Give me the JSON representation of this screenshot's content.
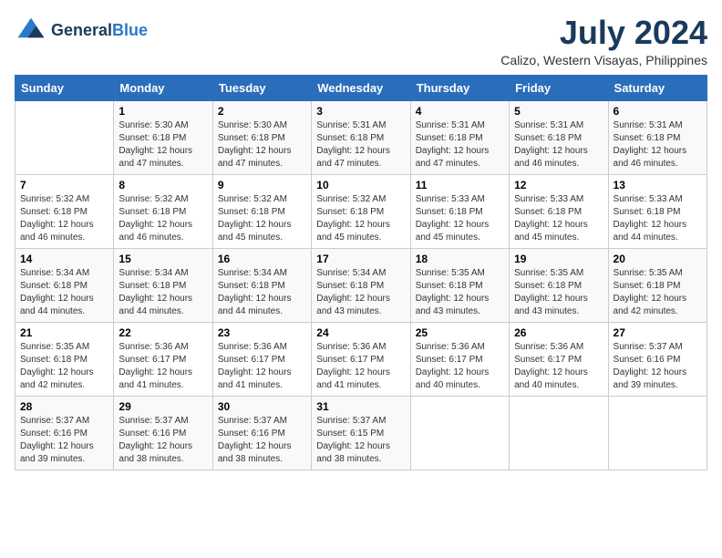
{
  "header": {
    "logo_line1": "General",
    "logo_line2": "Blue",
    "month": "July 2024",
    "location": "Calizo, Western Visayas, Philippines"
  },
  "weekdays": [
    "Sunday",
    "Monday",
    "Tuesday",
    "Wednesday",
    "Thursday",
    "Friday",
    "Saturday"
  ],
  "weeks": [
    [
      {
        "day": "",
        "info": ""
      },
      {
        "day": "1",
        "info": "Sunrise: 5:30 AM\nSunset: 6:18 PM\nDaylight: 12 hours\nand 47 minutes."
      },
      {
        "day": "2",
        "info": "Sunrise: 5:30 AM\nSunset: 6:18 PM\nDaylight: 12 hours\nand 47 minutes."
      },
      {
        "day": "3",
        "info": "Sunrise: 5:31 AM\nSunset: 6:18 PM\nDaylight: 12 hours\nand 47 minutes."
      },
      {
        "day": "4",
        "info": "Sunrise: 5:31 AM\nSunset: 6:18 PM\nDaylight: 12 hours\nand 47 minutes."
      },
      {
        "day": "5",
        "info": "Sunrise: 5:31 AM\nSunset: 6:18 PM\nDaylight: 12 hours\nand 46 minutes."
      },
      {
        "day": "6",
        "info": "Sunrise: 5:31 AM\nSunset: 6:18 PM\nDaylight: 12 hours\nand 46 minutes."
      }
    ],
    [
      {
        "day": "7",
        "info": "Sunrise: 5:32 AM\nSunset: 6:18 PM\nDaylight: 12 hours\nand 46 minutes."
      },
      {
        "day": "8",
        "info": "Sunrise: 5:32 AM\nSunset: 6:18 PM\nDaylight: 12 hours\nand 46 minutes."
      },
      {
        "day": "9",
        "info": "Sunrise: 5:32 AM\nSunset: 6:18 PM\nDaylight: 12 hours\nand 45 minutes."
      },
      {
        "day": "10",
        "info": "Sunrise: 5:32 AM\nSunset: 6:18 PM\nDaylight: 12 hours\nand 45 minutes."
      },
      {
        "day": "11",
        "info": "Sunrise: 5:33 AM\nSunset: 6:18 PM\nDaylight: 12 hours\nand 45 minutes."
      },
      {
        "day": "12",
        "info": "Sunrise: 5:33 AM\nSunset: 6:18 PM\nDaylight: 12 hours\nand 45 minutes."
      },
      {
        "day": "13",
        "info": "Sunrise: 5:33 AM\nSunset: 6:18 PM\nDaylight: 12 hours\nand 44 minutes."
      }
    ],
    [
      {
        "day": "14",
        "info": "Sunrise: 5:34 AM\nSunset: 6:18 PM\nDaylight: 12 hours\nand 44 minutes."
      },
      {
        "day": "15",
        "info": "Sunrise: 5:34 AM\nSunset: 6:18 PM\nDaylight: 12 hours\nand 44 minutes."
      },
      {
        "day": "16",
        "info": "Sunrise: 5:34 AM\nSunset: 6:18 PM\nDaylight: 12 hours\nand 44 minutes."
      },
      {
        "day": "17",
        "info": "Sunrise: 5:34 AM\nSunset: 6:18 PM\nDaylight: 12 hours\nand 43 minutes."
      },
      {
        "day": "18",
        "info": "Sunrise: 5:35 AM\nSunset: 6:18 PM\nDaylight: 12 hours\nand 43 minutes."
      },
      {
        "day": "19",
        "info": "Sunrise: 5:35 AM\nSunset: 6:18 PM\nDaylight: 12 hours\nand 43 minutes."
      },
      {
        "day": "20",
        "info": "Sunrise: 5:35 AM\nSunset: 6:18 PM\nDaylight: 12 hours\nand 42 minutes."
      }
    ],
    [
      {
        "day": "21",
        "info": "Sunrise: 5:35 AM\nSunset: 6:18 PM\nDaylight: 12 hours\nand 42 minutes."
      },
      {
        "day": "22",
        "info": "Sunrise: 5:36 AM\nSunset: 6:17 PM\nDaylight: 12 hours\nand 41 minutes."
      },
      {
        "day": "23",
        "info": "Sunrise: 5:36 AM\nSunset: 6:17 PM\nDaylight: 12 hours\nand 41 minutes."
      },
      {
        "day": "24",
        "info": "Sunrise: 5:36 AM\nSunset: 6:17 PM\nDaylight: 12 hours\nand 41 minutes."
      },
      {
        "day": "25",
        "info": "Sunrise: 5:36 AM\nSunset: 6:17 PM\nDaylight: 12 hours\nand 40 minutes."
      },
      {
        "day": "26",
        "info": "Sunrise: 5:36 AM\nSunset: 6:17 PM\nDaylight: 12 hours\nand 40 minutes."
      },
      {
        "day": "27",
        "info": "Sunrise: 5:37 AM\nSunset: 6:16 PM\nDaylight: 12 hours\nand 39 minutes."
      }
    ],
    [
      {
        "day": "28",
        "info": "Sunrise: 5:37 AM\nSunset: 6:16 PM\nDaylight: 12 hours\nand 39 minutes."
      },
      {
        "day": "29",
        "info": "Sunrise: 5:37 AM\nSunset: 6:16 PM\nDaylight: 12 hours\nand 38 minutes."
      },
      {
        "day": "30",
        "info": "Sunrise: 5:37 AM\nSunset: 6:16 PM\nDaylight: 12 hours\nand 38 minutes."
      },
      {
        "day": "31",
        "info": "Sunrise: 5:37 AM\nSunset: 6:15 PM\nDaylight: 12 hours\nand 38 minutes."
      },
      {
        "day": "",
        "info": ""
      },
      {
        "day": "",
        "info": ""
      },
      {
        "day": "",
        "info": ""
      }
    ]
  ]
}
